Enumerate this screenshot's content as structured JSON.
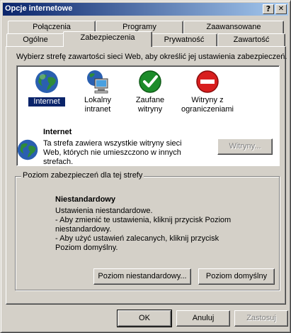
{
  "window": {
    "title": "Opcje internetowe",
    "help_label": "?",
    "close_label": "✕"
  },
  "tabs_top": [
    "Połączenia",
    "Programy",
    "Zaawansowane"
  ],
  "tabs_bottom": [
    "Ogólne",
    "Zabezpieczenia",
    "Prywatność",
    "Zawartość"
  ],
  "active_tab": "Zabezpieczenia",
  "panel": {
    "instruction": "Wybierz strefę zawartości sieci Web, aby określić jej ustawienia zabezpieczeń.",
    "zones": [
      {
        "label": "Internet",
        "icon": "globe-icon",
        "selected": true
      },
      {
        "label": "Lokalny intranet",
        "icon": "intranet-computer-icon",
        "selected": false
      },
      {
        "label": "Zaufane witryny",
        "icon": "trusted-check-icon",
        "selected": false
      },
      {
        "label": "Witryny z ograniczeniami",
        "icon": "restricted-no-entry-icon",
        "selected": false
      }
    ],
    "zone_info": {
      "name": "Internet",
      "description": "Ta strefa zawiera wszystkie witryny sieci Web, których nie umieszczono w innych strefach.",
      "sites_button": "Witryny..."
    },
    "security_level": {
      "group_label": "Poziom zabezpieczeń dla tej strefy",
      "level_name": "Niestandardowy",
      "line1": "Ustawienia niestandardowe.",
      "line2": "- Aby zmienić te ustawienia, kliknij przycisk Poziom niestandardowy.",
      "line3": "- Aby użyć ustawień zalecanych, kliknij przycisk Poziom domyślny.",
      "custom_button": "Poziom niestandardowy...",
      "default_button": "Poziom domyślny"
    }
  },
  "footer": {
    "ok": "OK",
    "cancel": "Anuluj",
    "apply": "Zastosuj"
  },
  "colors": {
    "title_start": "#0a246a",
    "title_end": "#a6caf0",
    "face": "#d4d0c8",
    "selection": "#0a246a"
  }
}
